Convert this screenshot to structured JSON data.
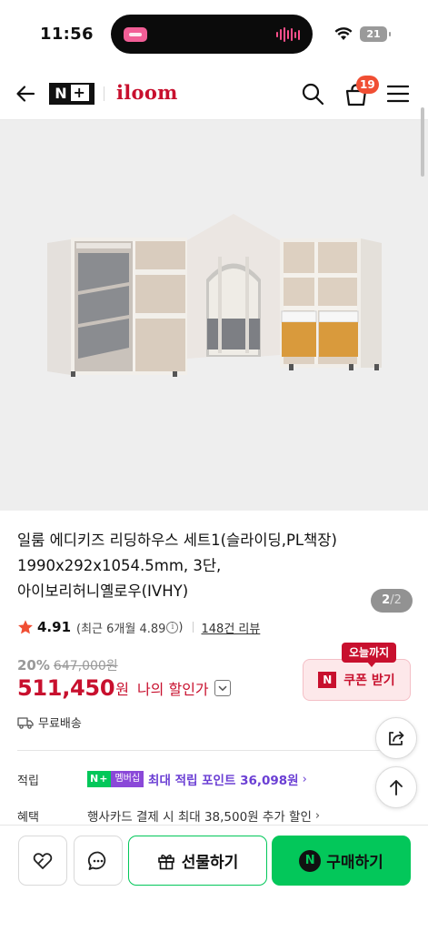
{
  "status_bar": {
    "time": "11:56",
    "battery": "21"
  },
  "header": {
    "brand_np": "N",
    "brand_plus": "+",
    "brand_name": "iloom",
    "cart_count": "19"
  },
  "gallery": {
    "current": "2",
    "separator": "/",
    "total": "2"
  },
  "product": {
    "title_line1": "일룸 에디키즈 리딩하우스 세트1(슬라이딩,PL책장)",
    "title_line2": "1990x292x1054.5mm, 3단,",
    "title_line3": "아이보리허니옐로우(IVHY)",
    "rating": "4.91",
    "rating_recent_prefix": "(최근 6개월 4.89",
    "rating_recent_suffix": ")",
    "review_link": "148건 리뷰",
    "discount_rate": "20%",
    "original_price": "647,000원",
    "sale_price": "511,450",
    "currency": "원",
    "my_price_label": "나의 할인가",
    "coupon_tag": "오늘까지",
    "coupon_n": "N",
    "coupon_label": "쿠폰 받기",
    "shipping": "무료배송"
  },
  "points": {
    "label": "적립",
    "np": "N+",
    "membership": "멤버십",
    "text": "최대 적립 포인트 36,098원"
  },
  "benefit": {
    "label": "혜택",
    "text": "행사카드 결제 시 최대 38,500원 추가 할인"
  },
  "bottom_bar": {
    "gift_label": "선물하기",
    "buy_n": "N",
    "buy_label": "구매하기"
  },
  "colors": {
    "brand_red": "#c8102e",
    "naver_green": "#03c75a",
    "points_purple": "#6b3fd4",
    "badge_orange": "#f04e33"
  },
  "icons": [
    "back-arrow-icon",
    "search-icon",
    "cart-icon",
    "menu-icon",
    "star-icon",
    "info-icon",
    "chevron-down-icon",
    "truck-icon",
    "share-icon",
    "arrow-up-icon",
    "like-icon",
    "chat-icon",
    "gift-icon"
  ]
}
